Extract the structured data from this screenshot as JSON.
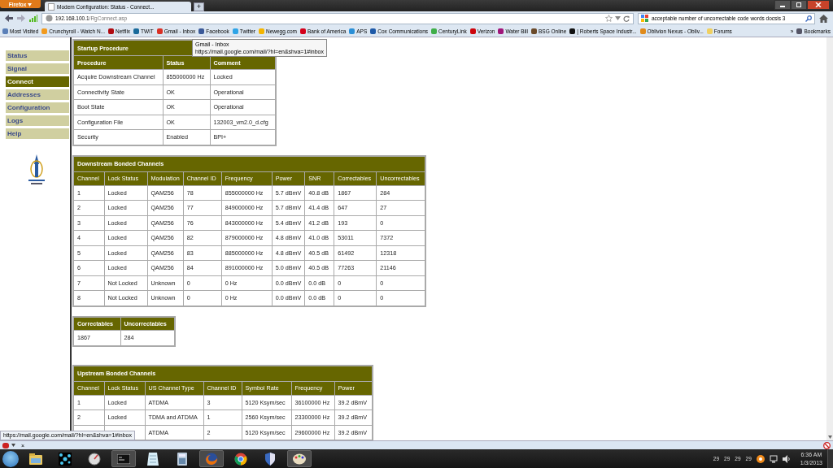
{
  "browser": {
    "menu_button": "Firefox",
    "tab_title": "Modem Configuration: Status - Connect...",
    "new_tab": "+",
    "url_host": "192.168.100.1",
    "url_path": "/RgConnect.asp",
    "search_query": "acceptable number of uncorrectable code words docsis 3",
    "bookmarks": [
      {
        "label": "Most Visited",
        "color": "#5a7fb8"
      },
      {
        "label": "Crunchyroll - Watch N...",
        "color": "#f29a1e"
      },
      {
        "label": "Netflix",
        "color": "#b00a10"
      },
      {
        "label": "TWiT",
        "color": "#1a6a9a"
      },
      {
        "label": "Gmail - Inbox",
        "color": "#d93025"
      },
      {
        "label": "Facebook",
        "color": "#3b5998"
      },
      {
        "label": "Twitter",
        "color": "#2fa4e7"
      },
      {
        "label": "Newegg.com",
        "color": "#f4b400"
      },
      {
        "label": "Bank of America",
        "color": "#d4001a"
      },
      {
        "label": "APS",
        "color": "#2b8fd6"
      },
      {
        "label": "Cox Communications",
        "color": "#1e5aa8"
      },
      {
        "label": "CenturyLink",
        "color": "#3fae49"
      },
      {
        "label": "Verizon",
        "color": "#cd040b"
      },
      {
        "label": "Water Bill",
        "color": "#a0157a"
      },
      {
        "label": "BSG Online",
        "color": "#6b4a2a"
      },
      {
        "label": "| Roberts Space Industr...",
        "color": "#111111"
      },
      {
        "label": "Oblivion Nexus - Obliv...",
        "color": "#e08a1a"
      },
      {
        "label": "Forums",
        "color": "#f0d060"
      }
    ],
    "overflow": "»",
    "bookmarks_menu": "Bookmarks"
  },
  "sidebar": {
    "items": [
      {
        "label": "Status",
        "selected": false
      },
      {
        "label": "Signal",
        "selected": false
      },
      {
        "label": "Connect",
        "selected": true
      },
      {
        "label": "Addresses",
        "selected": false
      },
      {
        "label": "Configuration",
        "selected": false
      },
      {
        "label": "Logs",
        "selected": false
      },
      {
        "label": "Help",
        "selected": false
      }
    ]
  },
  "startup": {
    "title": "Startup Procedure",
    "columns": [
      "Procedure",
      "Status",
      "Comment"
    ],
    "rows": [
      [
        "Acquire Downstream Channel",
        "855000000 Hz",
        "Locked"
      ],
      [
        "Connectivity State",
        "OK",
        "Operational"
      ],
      [
        "Boot State",
        "OK",
        "Operational"
      ],
      [
        "Configuration File",
        "OK",
        "132003_vm2.0_d.cfg"
      ],
      [
        "Security",
        "Enabled",
        "BPI+"
      ]
    ]
  },
  "downstream": {
    "title": "Downstream Bonded Channels",
    "columns": [
      "Channel",
      "Lock Status",
      "Modulation",
      "Channel ID",
      "Frequency",
      "Power",
      "SNR",
      "Correctables",
      "Uncorrectables"
    ],
    "rows": [
      [
        "1",
        "Locked",
        "QAM256",
        "78",
        "855000000 Hz",
        "5.7 dBmV",
        "40.8 dB",
        "1867",
        "284"
      ],
      [
        "2",
        "Locked",
        "QAM256",
        "77",
        "849000000 Hz",
        "5.7 dBmV",
        "41.4 dB",
        "647",
        "27"
      ],
      [
        "3",
        "Locked",
        "QAM256",
        "76",
        "843000000 Hz",
        "5.4 dBmV",
        "41.2 dB",
        "193",
        "0"
      ],
      [
        "4",
        "Locked",
        "QAM256",
        "82",
        "879000000 Hz",
        "4.8 dBmV",
        "41.0 dB",
        "53011",
        "7372"
      ],
      [
        "5",
        "Locked",
        "QAM256",
        "83",
        "885000000 Hz",
        "4.8 dBmV",
        "40.5 dB",
        "61492",
        "12318"
      ],
      [
        "6",
        "Locked",
        "QAM256",
        "84",
        "891000000 Hz",
        "5.0 dBmV",
        "40.5 dB",
        "77263",
        "21146"
      ],
      [
        "7",
        "Not Locked",
        "Unknown",
        "0",
        "0 Hz",
        "0.0 dBmV",
        "0.0 dB",
        "0",
        "0"
      ],
      [
        "8",
        "Not Locked",
        "Unknown",
        "0",
        "0 Hz",
        "0.0 dBmV",
        "0.0 dB",
        "0",
        "0"
      ]
    ]
  },
  "totals": {
    "columns": [
      "Correctables",
      "Uncorrectables"
    ],
    "rows": [
      [
        "1867",
        "284"
      ]
    ]
  },
  "upstream": {
    "title": "Upstream Bonded Channels",
    "columns": [
      "Channel",
      "Lock Status",
      "US Channel Type",
      "Channel ID",
      "Symbol Rate",
      "Frequency",
      "Power"
    ],
    "rows": [
      [
        "1",
        "Locked",
        "ATDMA",
        "3",
        "5120 Ksym/sec",
        "36100000 Hz",
        "39.2 dBmV"
      ],
      [
        "2",
        "Locked",
        "TDMA and ATDMA",
        "1",
        "2560 Ksym/sec",
        "23300000 Hz",
        "39.2 dBmV"
      ],
      [
        null,
        null,
        "ATDMA",
        "2",
        "5120 Ksym/sec",
        "29600000 Hz",
        "39.2 dBmV"
      ]
    ]
  },
  "tooltip": {
    "title": "Gmail - Inbox",
    "url": "https://mail.google.com/mail/?hl=en&shva=1#inbox"
  },
  "status_url": "https://mail.google.com/mail/?hl=en&shva=1#inbox",
  "addon_close": "×",
  "taskbar": {
    "apps": [
      {
        "kind": "folder",
        "selected": false
      },
      {
        "kind": "network",
        "selected": false
      },
      {
        "kind": "gauge",
        "selected": false
      },
      {
        "kind": "terminal",
        "selected": true
      },
      {
        "kind": "notepad",
        "selected": false
      },
      {
        "kind": "calculator",
        "selected": false
      },
      {
        "kind": "firefox",
        "selected": true
      },
      {
        "kind": "chrome",
        "selected": false
      },
      {
        "kind": "shield",
        "selected": false
      },
      {
        "kind": "paint",
        "selected": true
      }
    ],
    "tray_readings": [
      "29",
      "29",
      "29",
      "29"
    ],
    "time": "6:36 AM",
    "date": "1/3/2013"
  }
}
